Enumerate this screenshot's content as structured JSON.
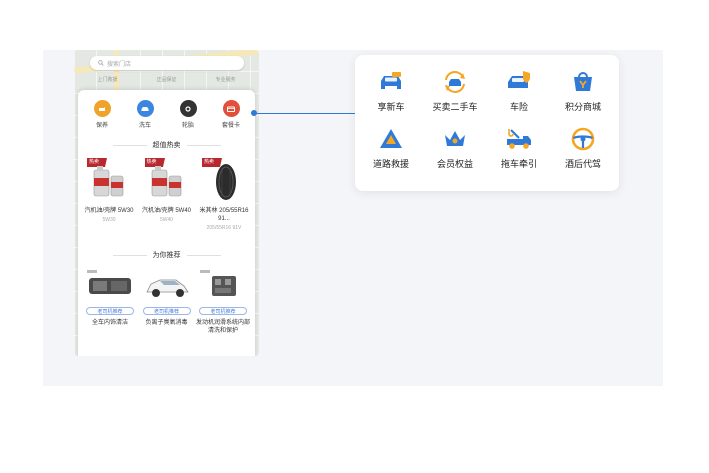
{
  "colors": {
    "accent_blue": "#2f7ad9",
    "accent_orange": "#f5a623",
    "tag_red": "#b8292f"
  },
  "phone": {
    "search_placeholder": "搜索门店",
    "taglines": [
      "上门救援",
      "正品保证",
      "专业服务"
    ],
    "quick_actions": [
      {
        "label": "保养",
        "icon": "oil-can-icon",
        "color": "#f0a32a"
      },
      {
        "label": "洗车",
        "icon": "car-wash-icon",
        "color": "#3b86e0"
      },
      {
        "label": "轮胎",
        "icon": "tire-icon",
        "color": "#333333"
      },
      {
        "label": "套餐卡",
        "icon": "card-icon",
        "color": "#e0503a"
      }
    ],
    "hot_title": "超值热卖",
    "products": [
      {
        "name": "汽机油/壳牌 5W30",
        "spec": "5W30",
        "tag": "热卖",
        "icon": "oil-bottle-icon"
      },
      {
        "name": "汽机油/壳牌 5W40",
        "spec": "5W40",
        "tag": "热卖",
        "icon": "oil-bottle-icon"
      },
      {
        "name": "米其林 205/55R16 91...",
        "spec": "205/55R16 91V",
        "tag": "热卖",
        "icon": "tire-product-icon"
      }
    ],
    "rec_title": "为你推荐",
    "recommendations": [
      {
        "name": "全车内饰清洁",
        "button": "老司机推荐",
        "icon": "car-interior-icon"
      },
      {
        "name": "负离子臭氧消毒",
        "button": "老司机推荐",
        "icon": "white-car-icon"
      },
      {
        "name": "发动机润滑系统内部清洗和保护",
        "button": "老司机推荐",
        "icon": "engine-icon"
      }
    ],
    "handle_glyph": "︿"
  },
  "services": [
    {
      "label": "享新车",
      "icon": "new-car-icon"
    },
    {
      "label": "买卖二手车",
      "icon": "used-car-trade-icon"
    },
    {
      "label": "车险",
      "icon": "car-insurance-icon"
    },
    {
      "label": "积分商城",
      "icon": "points-mall-icon"
    },
    {
      "label": "道路救援",
      "icon": "road-rescue-icon"
    },
    {
      "label": "会员权益",
      "icon": "member-crown-icon"
    },
    {
      "label": "拖车牵引",
      "icon": "tow-truck-icon"
    },
    {
      "label": "酒后代驾",
      "icon": "steering-wheel-icon"
    }
  ]
}
